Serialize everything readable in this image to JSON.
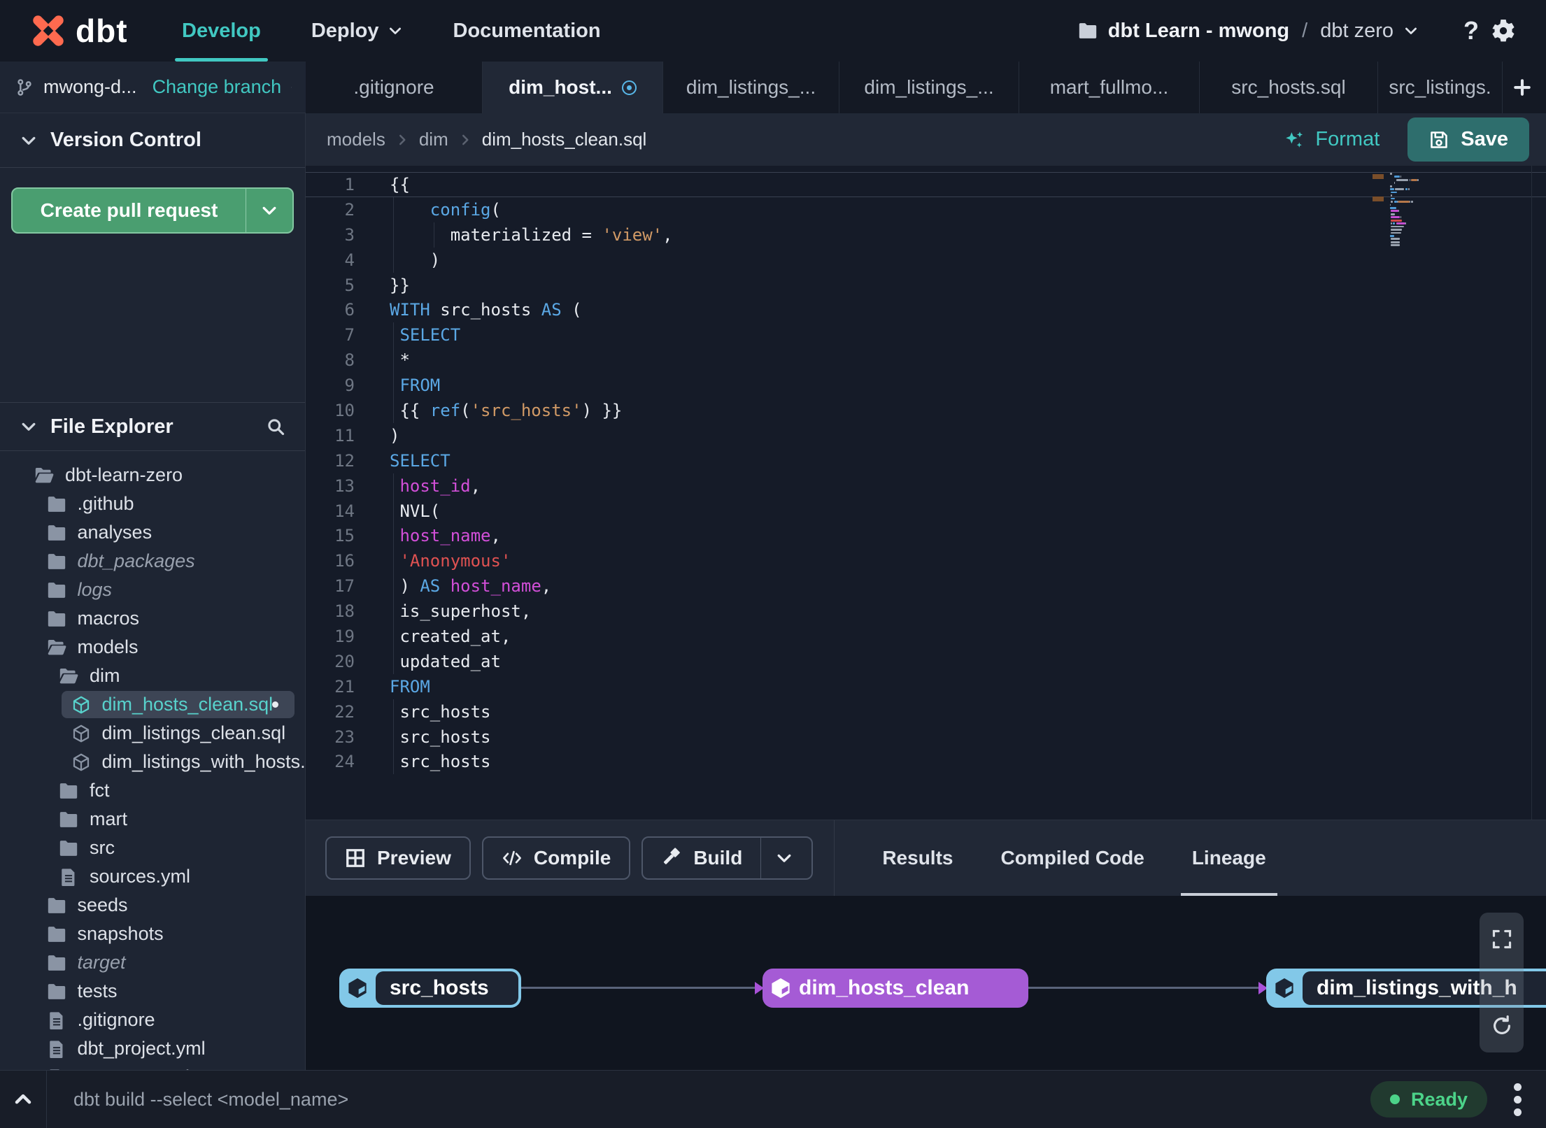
{
  "colors": {
    "accent_teal": "#41c8c2",
    "brand_orange": "#ff6a4f",
    "pr_button_green": "#4a9e70",
    "save_button_teal": "#2e6e6d",
    "node_blue": "#82c8e8",
    "node_purple": "#a55bd5",
    "ready_green": "#4cd389",
    "code_keyword": "#5ba8e5",
    "code_string": "#d19a66",
    "code_string_alt": "#e05252",
    "code_identifier": "#d24fd8"
  },
  "header": {
    "nav": [
      {
        "label": "Develop",
        "active": true,
        "caret": false
      },
      {
        "label": "Deploy",
        "active": false,
        "caret": true
      },
      {
        "label": "Documentation",
        "active": false,
        "caret": false
      }
    ],
    "account": "dbt Learn - mwong",
    "path_separator": "/",
    "project": "dbt zero",
    "help_label": "?"
  },
  "logo": {
    "text": "dbt"
  },
  "branch_bar": {
    "branch_name": "mwong-d...",
    "change_branch_label": "Change branch"
  },
  "file_tabs": {
    "tabs": [
      {
        "label": ".gitignore",
        "active": false,
        "modified": false
      },
      {
        "label": "dim_host...",
        "active": true,
        "modified": true
      },
      {
        "label": "dim_listings_...",
        "active": false,
        "modified": false
      },
      {
        "label": "dim_listings_...",
        "active": false,
        "modified": false
      },
      {
        "label": "mart_fullmo...",
        "active": false,
        "modified": false
      },
      {
        "label": "src_hosts.sql",
        "active": false,
        "modified": false
      },
      {
        "label": "src_listings.",
        "active": false,
        "modified": false
      }
    ]
  },
  "breadcrumb": {
    "segments": [
      "models",
      "dim",
      "dim_hosts_clean.sql"
    ]
  },
  "editor_actions": {
    "format_label": "Format",
    "save_label": "Save"
  },
  "version_control": {
    "title": "Version Control",
    "create_pr_label": "Create pull request"
  },
  "file_explorer": {
    "title": "File Explorer",
    "tree": [
      {
        "name": "dbt-learn-zero",
        "icon": "folder-open",
        "depth": 0
      },
      {
        "name": ".github",
        "icon": "folder",
        "depth": 1
      },
      {
        "name": "analyses",
        "icon": "folder",
        "depth": 1
      },
      {
        "name": "dbt_packages",
        "icon": "folder",
        "depth": 1,
        "italic": true
      },
      {
        "name": "logs",
        "icon": "folder",
        "depth": 1,
        "italic": true
      },
      {
        "name": "macros",
        "icon": "folder",
        "depth": 1
      },
      {
        "name": "models",
        "icon": "folder-open",
        "depth": 1
      },
      {
        "name": "dim",
        "icon": "folder-open",
        "depth": 2
      },
      {
        "name": "dim_hosts_clean.sql",
        "icon": "model",
        "depth": 3,
        "selected": true,
        "modified": true
      },
      {
        "name": "dim_listings_clean.sql",
        "icon": "model",
        "depth": 3
      },
      {
        "name": "dim_listings_with_hosts...",
        "icon": "model",
        "depth": 3
      },
      {
        "name": "fct",
        "icon": "folder",
        "depth": 2
      },
      {
        "name": "mart",
        "icon": "folder",
        "depth": 2
      },
      {
        "name": "src",
        "icon": "folder",
        "depth": 2
      },
      {
        "name": "sources.yml",
        "icon": "file",
        "depth": 2
      },
      {
        "name": "seeds",
        "icon": "folder",
        "depth": 1
      },
      {
        "name": "snapshots",
        "icon": "folder",
        "depth": 1
      },
      {
        "name": "target",
        "icon": "folder",
        "depth": 1,
        "italic": true
      },
      {
        "name": "tests",
        "icon": "folder",
        "depth": 1
      },
      {
        "name": ".gitignore",
        "icon": "file",
        "depth": 1
      },
      {
        "name": "dbt_project.yml",
        "icon": "file",
        "depth": 1
      },
      {
        "name": "README.md",
        "icon": "file",
        "depth": 1
      }
    ]
  },
  "editor": {
    "lines": [
      {
        "cur": true,
        "g": [],
        "t": [
          [
            "p",
            "{{"
          ]
        ]
      },
      {
        "g": [
          0
        ],
        "t": [
          [
            "p",
            "    "
          ],
          [
            "k",
            "config"
          ],
          [
            "p",
            "("
          ]
        ]
      },
      {
        "g": [
          0,
          4
        ],
        "t": [
          [
            "p",
            "      materialized = "
          ],
          [
            "s",
            "'view'"
          ],
          [
            "p",
            ","
          ]
        ]
      },
      {
        "g": [
          0
        ],
        "t": [
          [
            "p",
            "    )"
          ]
        ]
      },
      {
        "g": [],
        "t": [
          [
            "p",
            "}}"
          ]
        ]
      },
      {
        "g": [],
        "t": [
          [
            "k",
            "WITH"
          ],
          [
            "p",
            " src_hosts "
          ],
          [
            "k",
            "AS"
          ],
          [
            "p",
            " ("
          ]
        ]
      },
      {
        "g": [
          0
        ],
        "t": [
          [
            "p",
            " "
          ],
          [
            "k",
            "SELECT"
          ]
        ]
      },
      {
        "g": [
          0
        ],
        "t": [
          [
            "p",
            " *"
          ]
        ]
      },
      {
        "g": [
          0
        ],
        "t": [
          [
            "p",
            " "
          ],
          [
            "k",
            "FROM"
          ]
        ]
      },
      {
        "g": [
          0
        ],
        "t": [
          [
            "p",
            " {{ "
          ],
          [
            "k",
            "ref"
          ],
          [
            "p",
            "("
          ],
          [
            "s",
            "'src_hosts'"
          ],
          [
            "p",
            ") }}"
          ]
        ]
      },
      {
        "g": [],
        "t": [
          [
            "p",
            ")"
          ]
        ]
      },
      {
        "g": [],
        "t": [
          [
            "k",
            "SELECT"
          ]
        ]
      },
      {
        "g": [
          0
        ],
        "t": [
          [
            "p",
            " "
          ],
          [
            "m",
            "host_id"
          ],
          [
            "p",
            ","
          ]
        ]
      },
      {
        "g": [
          0
        ],
        "t": [
          [
            "p",
            " NVL("
          ]
        ]
      },
      {
        "g": [
          0
        ],
        "t": [
          [
            "p",
            " "
          ],
          [
            "m",
            "host_name"
          ],
          [
            "p",
            ","
          ]
        ]
      },
      {
        "g": [
          0
        ],
        "t": [
          [
            "p",
            " "
          ],
          [
            "r",
            "'Anonymous'"
          ]
        ]
      },
      {
        "g": [
          0
        ],
        "t": [
          [
            "p",
            " ) "
          ],
          [
            "k",
            "AS"
          ],
          [
            "p",
            " "
          ],
          [
            "m",
            "host_name"
          ],
          [
            "p",
            ","
          ]
        ]
      },
      {
        "g": [
          0
        ],
        "t": [
          [
            "p",
            " is_superhost,"
          ]
        ]
      },
      {
        "g": [
          0
        ],
        "t": [
          [
            "p",
            " created_at,"
          ]
        ]
      },
      {
        "g": [
          0
        ],
        "t": [
          [
            "p",
            " updated_at"
          ]
        ]
      },
      {
        "g": [],
        "t": [
          [
            "k",
            "FROM"
          ]
        ]
      },
      {
        "g": [
          0
        ],
        "t": [
          [
            "p",
            " src_hosts"
          ]
        ]
      },
      {
        "g": [
          0
        ],
        "t": [
          [
            "p",
            " src_hosts"
          ]
        ]
      },
      {
        "g": [
          0
        ],
        "t": [
          [
            "p",
            " src_hosts"
          ]
        ]
      }
    ]
  },
  "bottom_panel": {
    "buttons": [
      {
        "label": "Preview",
        "icon": "grid",
        "split_caret": false
      },
      {
        "label": "Compile",
        "icon": "code",
        "split_caret": false
      },
      {
        "label": "Build",
        "icon": "hammer",
        "split_caret": true
      }
    ],
    "tabs": [
      {
        "label": "Results",
        "active": false
      },
      {
        "label": "Compiled Code",
        "active": false
      },
      {
        "label": "Lineage",
        "active": true
      }
    ]
  },
  "lineage": {
    "nodes": [
      {
        "label": "src_hosts",
        "style": "source"
      },
      {
        "label": "dim_hosts_clean",
        "style": "model"
      },
      {
        "label": "dim_listings_with_h",
        "style": "source"
      }
    ]
  },
  "status_bar": {
    "command_placeholder": "dbt build --select <model_name>",
    "status_label": "Ready"
  }
}
